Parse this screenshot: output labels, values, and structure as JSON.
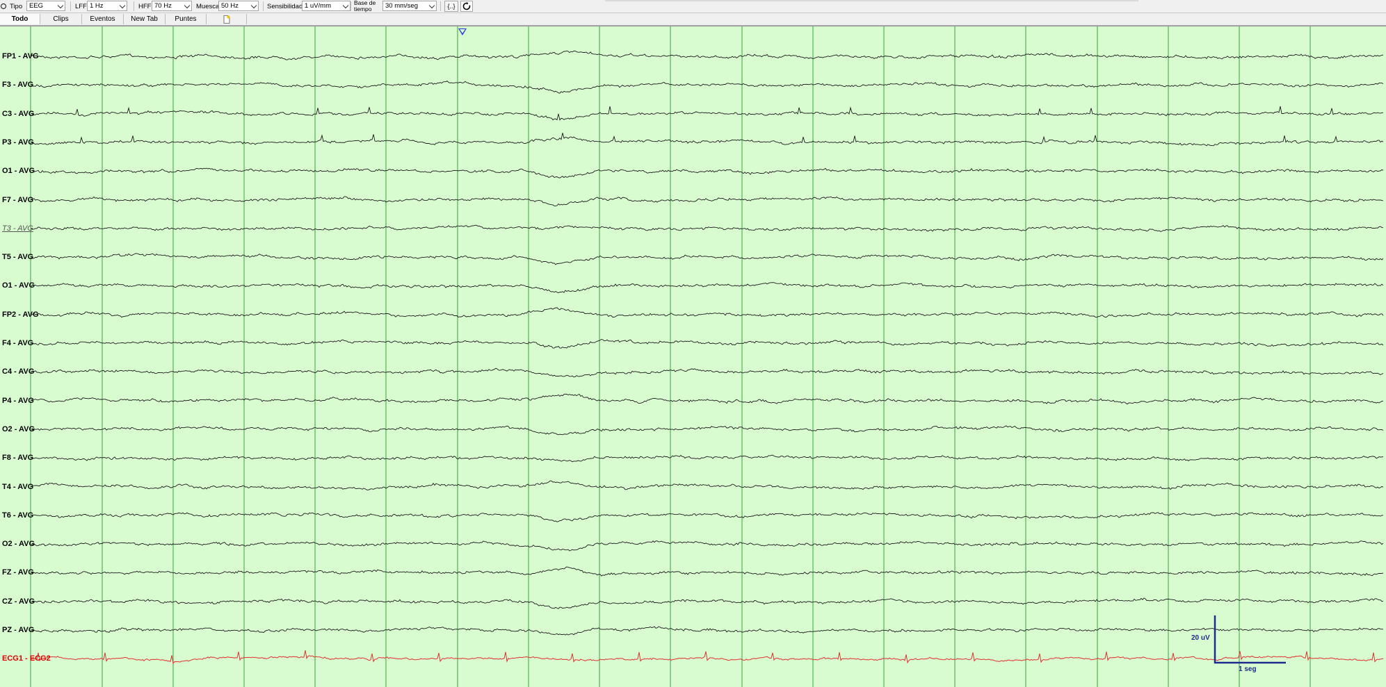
{
  "toolbar": {
    "tipo_label": "Tipo",
    "tipo_value": "EEG",
    "lff_label": "LFF",
    "lff_value": "1 Hz",
    "hff_label": "HFF",
    "hff_value": "70 Hz",
    "muesca_label": "Muesca",
    "muesca_value": "50 Hz",
    "sens_label": "Sensibilidad",
    "sens_value": "1 uV/mm",
    "base_label_1": "Base de",
    "base_label_2": "tiempo",
    "base_value": "30 mm/seg",
    "bracket_button": "{..}",
    "refresh_icon": "refresh-icon"
  },
  "tabs": [
    "Todo",
    "Clips",
    "Eventos",
    "New Tab",
    "Puntes"
  ],
  "channels": [
    {
      "label": "FP1 - AVG",
      "style": "normal"
    },
    {
      "label": "F3 - AVG",
      "style": "normal"
    },
    {
      "label": "C3 - AVG",
      "style": "normal"
    },
    {
      "label": "P3 - AVG",
      "style": "normal"
    },
    {
      "label": "O1 - AVG",
      "style": "normal"
    },
    {
      "label": "F7 - AVG",
      "style": "normal"
    },
    {
      "label": "T3 - AVG",
      "style": "dim"
    },
    {
      "label": "T5 - AVG",
      "style": "normal"
    },
    {
      "label": "O1 - AVG",
      "style": "normal"
    },
    {
      "label": "FP2 - AVG",
      "style": "normal"
    },
    {
      "label": "F4 - AVG",
      "style": "normal"
    },
    {
      "label": "C4 - AVG",
      "style": "normal"
    },
    {
      "label": "P4 - AVG",
      "style": "normal"
    },
    {
      "label": "O2 - AVG",
      "style": "normal"
    },
    {
      "label": "F8 - AVG",
      "style": "normal"
    },
    {
      "label": "T4 - AVG",
      "style": "normal"
    },
    {
      "label": "T6 - AVG",
      "style": "normal"
    },
    {
      "label": "O2 - AVG",
      "style": "normal"
    },
    {
      "label": "FZ - AVG",
      "style": "normal"
    },
    {
      "label": "CZ - AVG",
      "style": "normal"
    },
    {
      "label": "PZ - AVG",
      "style": "normal"
    },
    {
      "label": "ECG1 - ECG2",
      "style": "ecg"
    }
  ],
  "scale": {
    "amplitude": "20 uV",
    "time": "1 seg"
  },
  "colors": {
    "background": "#d8fbd0",
    "grid": "#3aa33a",
    "trace": "#1a1a1a",
    "ecg": "#e03030",
    "scale": "#1f2a8c"
  }
}
